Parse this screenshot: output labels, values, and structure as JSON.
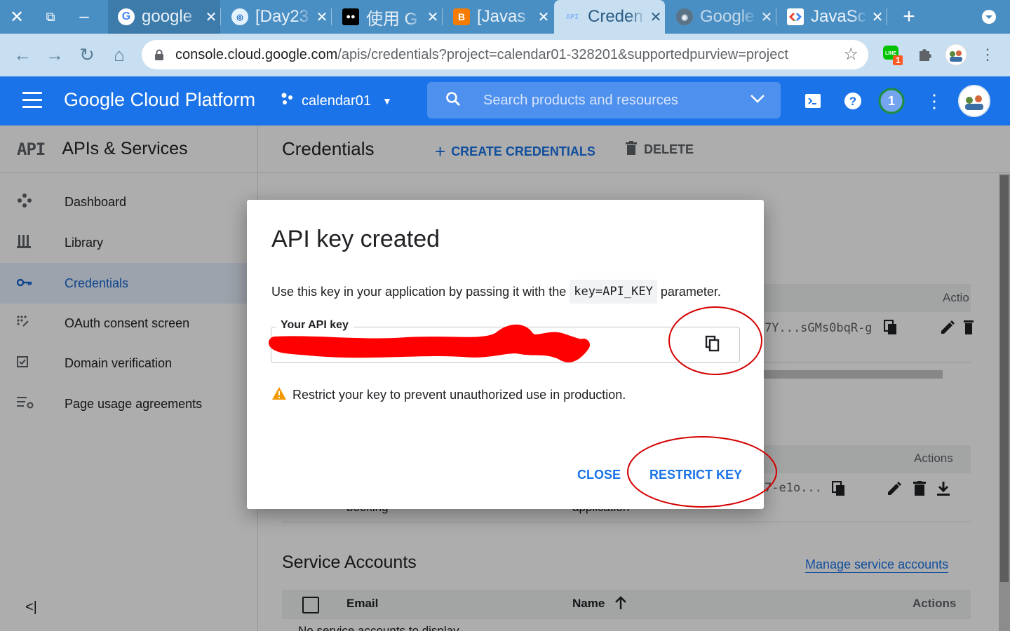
{
  "browser": {
    "tabs": [
      {
        "title": "google",
        "favicon": "google-icon",
        "color": "#ffffff"
      },
      {
        "title": "[Day23",
        "favicon": "ithome-icon",
        "color": "#e3f2fd"
      },
      {
        "title": "使用 G",
        "favicon": "medium-icon",
        "color": "#000000"
      },
      {
        "title": "[Javas",
        "favicon": "blogger-icon",
        "color": "#f57c00"
      },
      {
        "title": "Creden",
        "favicon": "api-icon",
        "color": "#c7dff0"
      },
      {
        "title": "Google",
        "favicon": "github-icon",
        "color": "#666666"
      },
      {
        "title": "JavaSc",
        "favicon": "google-dev-icon",
        "color": "#ffffff"
      }
    ],
    "url_host": "console.cloud.google.com",
    "url_path": "/apis/credentials?project=calendar01-328201&supportedpurview=project",
    "extension_badge": "1"
  },
  "gcp": {
    "brand": "Google Cloud Platform",
    "project": "calendar01",
    "search_placeholder": "Search products and resources",
    "notification_count": "1"
  },
  "sidebar": {
    "logo": "API",
    "title": "APIs & Services",
    "items": [
      {
        "label": "Dashboard",
        "icon": "dashboard-icon"
      },
      {
        "label": "Library",
        "icon": "library-icon"
      },
      {
        "label": "Credentials",
        "icon": "key-icon"
      },
      {
        "label": "OAuth consent screen",
        "icon": "oauth-icon"
      },
      {
        "label": "Domain verification",
        "icon": "checkbox-icon"
      },
      {
        "label": "Page usage agreements",
        "icon": "settings-list-icon"
      }
    ],
    "collapse_glyph": "<|"
  },
  "main": {
    "title": "Credentials",
    "create_label": "CREATE CREDENTIALS",
    "delete_label": "DELETE",
    "api_keys": {
      "actions_header": "Actio",
      "key_partial": "7Y...sGMs0bqR-g"
    },
    "oauth": {
      "actions_header": "Actions",
      "client_partial": "7-e1o...",
      "name_partial": "booking",
      "type_partial": "application"
    },
    "service_accounts": {
      "title": "Service Accounts",
      "manage_link": "Manage service accounts",
      "col_email": "Email",
      "col_name": "Name",
      "col_actions": "Actions",
      "empty_partial": "No service accounts to display"
    }
  },
  "dialog": {
    "title": "API key created",
    "desc_before": "Use this key in your application by passing it with the",
    "desc_code": "key=API_KEY",
    "desc_after": "parameter.",
    "field_label": "Your API key",
    "warning": "Restrict your key to prevent unauthorized use in production.",
    "close_label": "CLOSE",
    "restrict_label": "RESTRICT KEY"
  },
  "colors": {
    "tabstrip": "#4a8fc4",
    "gcp_header": "#1a73e8",
    "accent": "#1a73e8",
    "redaction": "#ff0000",
    "annotation": "#d50000",
    "warning": "#f29900"
  }
}
